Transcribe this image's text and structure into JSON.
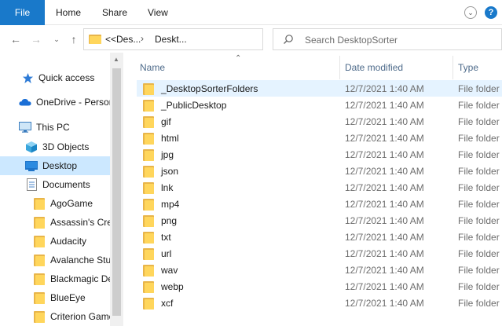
{
  "ribbon": {
    "tabs": [
      "File",
      "Home",
      "Share",
      "View"
    ],
    "collapse_icon": "chevron-down-icon",
    "help_icon": "help-icon"
  },
  "address": {
    "overflow": "<<",
    "crumbs": [
      "Des...",
      "Deskt..."
    ],
    "search_placeholder": "Search DesktopSorter"
  },
  "nav": {
    "items": [
      {
        "label": "Quick access",
        "icon": "star-icon"
      },
      {
        "label": "OneDrive - Person",
        "icon": "cloud-icon"
      },
      {
        "label": "This PC",
        "icon": "computer-icon"
      },
      {
        "label": "3D Objects",
        "icon": "cube-icon"
      },
      {
        "label": "Desktop",
        "icon": "desktop-icon"
      },
      {
        "label": "Documents",
        "icon": "document-icon"
      },
      {
        "label": "AgoGame",
        "icon": "folder-icon"
      },
      {
        "label": "Assassin's Cree",
        "icon": "folder-icon"
      },
      {
        "label": "Audacity",
        "icon": "folder-icon"
      },
      {
        "label": "Avalanche Stud",
        "icon": "folder-icon"
      },
      {
        "label": "Blackmagic De",
        "icon": "folder-icon"
      },
      {
        "label": "BlueEye",
        "icon": "folder-icon"
      },
      {
        "label": "Criterion Game",
        "icon": "folder-icon"
      }
    ]
  },
  "files": {
    "columns": [
      "Name",
      "Date modified",
      "Type"
    ],
    "rows": [
      {
        "name": "_DesktopSorterFolders",
        "date": "12/7/2021 1:40 AM",
        "type": "File folder"
      },
      {
        "name": "_PublicDesktop",
        "date": "12/7/2021 1:40 AM",
        "type": "File folder"
      },
      {
        "name": "gif",
        "date": "12/7/2021 1:40 AM",
        "type": "File folder"
      },
      {
        "name": "html",
        "date": "12/7/2021 1:40 AM",
        "type": "File folder"
      },
      {
        "name": "jpg",
        "date": "12/7/2021 1:40 AM",
        "type": "File folder"
      },
      {
        "name": "json",
        "date": "12/7/2021 1:40 AM",
        "type": "File folder"
      },
      {
        "name": "lnk",
        "date": "12/7/2021 1:40 AM",
        "type": "File folder"
      },
      {
        "name": "mp4",
        "date": "12/7/2021 1:40 AM",
        "type": "File folder"
      },
      {
        "name": "png",
        "date": "12/7/2021 1:40 AM",
        "type": "File folder"
      },
      {
        "name": "txt",
        "date": "12/7/2021 1:40 AM",
        "type": "File folder"
      },
      {
        "name": "url",
        "date": "12/7/2021 1:40 AM",
        "type": "File folder"
      },
      {
        "name": "wav",
        "date": "12/7/2021 1:40 AM",
        "type": "File folder"
      },
      {
        "name": "webp",
        "date": "12/7/2021 1:40 AM",
        "type": "File folder"
      },
      {
        "name": "xcf",
        "date": "12/7/2021 1:40 AM",
        "type": "File folder"
      }
    ]
  },
  "colors": {
    "accent": "#1979ca",
    "selected": "#cce8ff",
    "hover": "#e5f3ff",
    "folder": "#ffd65c"
  }
}
